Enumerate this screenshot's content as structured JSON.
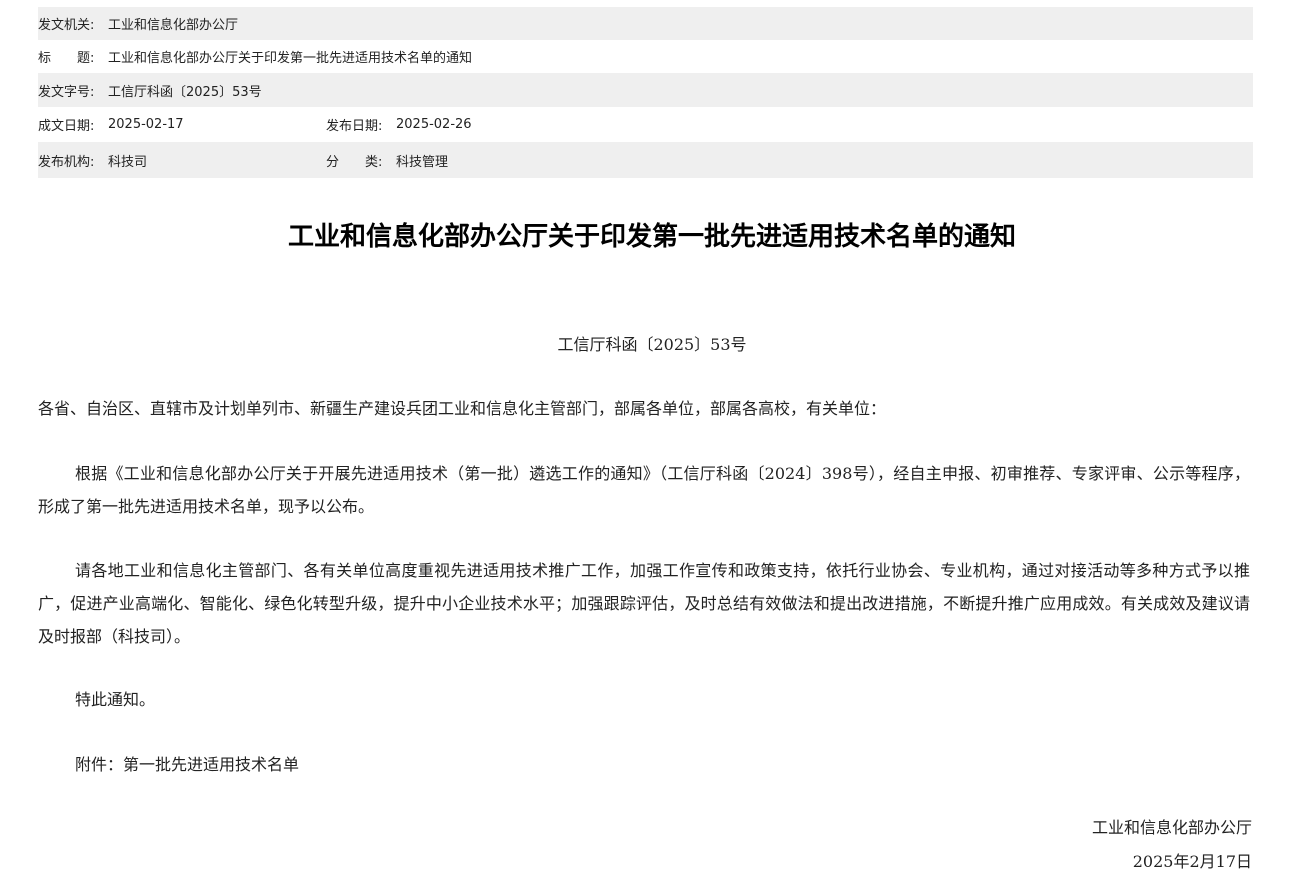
{
  "meta": {
    "issuer": {
      "label": "发文机关:",
      "value": "工业和信息化部办公厅"
    },
    "title": {
      "label": "标　　题:",
      "value": "工业和信息化部办公厅关于印发第一批先进适用技术名单的通知"
    },
    "doc_no": {
      "label": "发文字号:",
      "value": "工信厅科函〔2025〕53号"
    },
    "written_date": {
      "label": "成文日期:",
      "value": "2025-02-17"
    },
    "publish_date": {
      "label": "发布日期:",
      "value": "2025-02-26"
    },
    "publisher": {
      "label": "发布机构:",
      "value": "科技司"
    },
    "category": {
      "label": "分　　类:",
      "value": "科技管理"
    }
  },
  "document": {
    "title": "工业和信息化部办公厅关于印发第一批先进适用技术名单的通知",
    "doc_number": "工信厅科函〔2025〕53号",
    "salutation": "各省、自治区、直辖市及计划单列市、新疆生产建设兵团工业和信息化主管部门，部属各单位，部属各高校，有关单位：",
    "paragraphs": [
      "根据《工业和信息化部办公厅关于开展先进适用技术（第一批）遴选工作的通知》（工信厅科函〔2024〕398号），经自主申报、初审推荐、专家评审、公示等程序，形成了第一批先进适用技术名单，现予以公布。",
      "请各地工业和信息化主管部门、各有关单位高度重视先进适用技术推广工作，加强工作宣传和政策支持，依托行业协会、专业机构，通过对接活动等多种方式予以推广，促进产业高端化、智能化、绿色化转型升级，提升中小企业技术水平；加强跟踪评估，及时总结有效做法和提出改进措施，不断提升推广应用成效。有关成效及建议请及时报部（科技司）。",
      "特此通知。",
      "附件：第一批先进适用技术名单"
    ],
    "signature_org": "工业和信息化部办公厅",
    "signature_date": "2025年2月17日"
  }
}
